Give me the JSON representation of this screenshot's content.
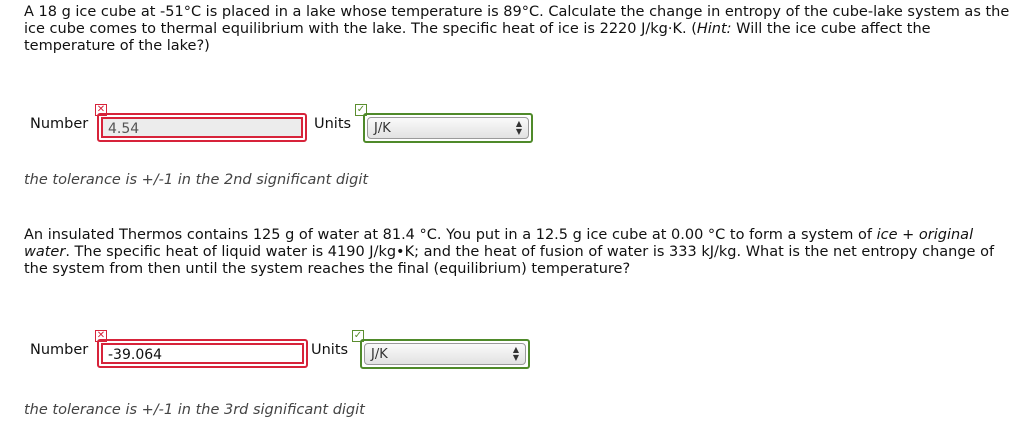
{
  "question1": {
    "part1": "A 18 g ice cube at -51°C is placed in a lake whose temperature is 89°C. Calculate the change in entropy of the cube-lake system as the ice cube comes to thermal equilibrium with the lake. The specific heat of ice is 2220 J/kg·K. (",
    "hint_label": "Hint:",
    "part2": " Will the ice cube affect the temperature of the lake?)",
    "number_label": "Number",
    "number_value": "4.54",
    "number_status": "incorrect",
    "units_label": "Units",
    "units_value": "J/K",
    "units_status": "correct",
    "tolerance": "the tolerance is +/-1 in the 2nd significant digit"
  },
  "question2": {
    "part1": "An insulated Thermos contains 125 g of water at 81.4 °C. You put in a 12.5 g ice cube at 0.00 °C to form a system of ",
    "italic_text": "ice + original water",
    "part2": ". The specific heat of liquid water is 4190 J/kg•K; and the heat of fusion of water is 333 kJ/kg. What is the net entropy change of the system from then until the system reaches the final (equilibrium) temperature?",
    "number_label": "Number",
    "number_value": "-39.064",
    "number_status": "incorrect",
    "units_label": "Units",
    "units_value": "J/K",
    "units_status": "correct",
    "tolerance": "the tolerance is +/-1 in the 3rd significant digit"
  },
  "icons": {
    "incorrect": "x-icon",
    "correct": "check-icon"
  },
  "colors": {
    "incorrect": "#d7233a",
    "correct": "#4f8a2a",
    "tolerance_text": "#444444"
  }
}
